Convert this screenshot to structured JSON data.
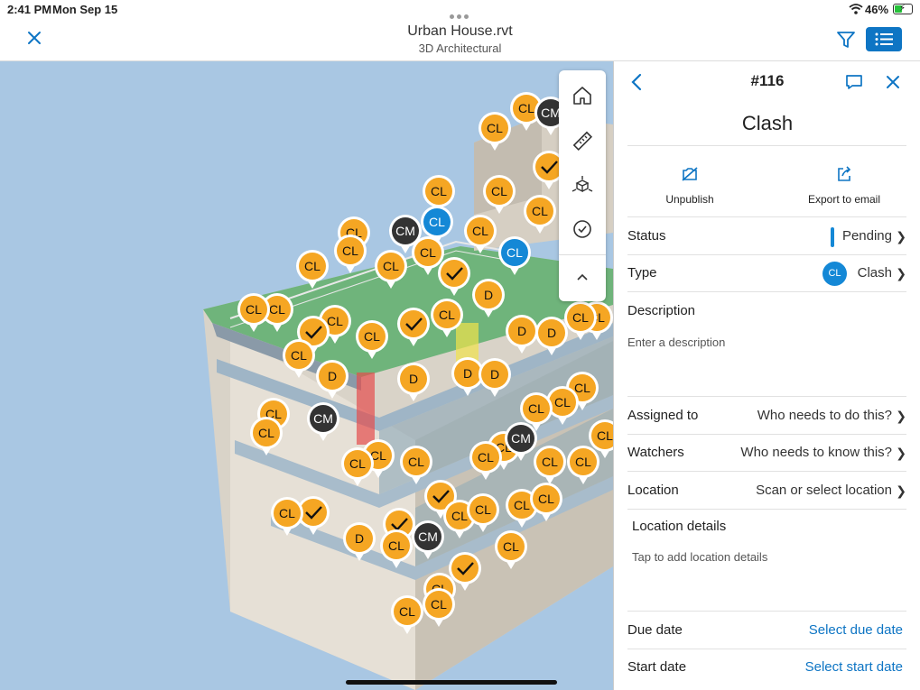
{
  "status_bar": {
    "time": "2:41 PM",
    "date": "Mon Sep 15",
    "battery": "46%",
    "battery_level": 0.46
  },
  "header": {
    "title": "Urban House.rvt",
    "subtitle": "3D Architectural"
  },
  "colors": {
    "accent": "#0e75c4",
    "pin_orange": "#f5a623",
    "pin_dark": "#333333",
    "pin_blue": "#1488d6",
    "sky": "#a9c7e3"
  },
  "toolbar": {
    "tools": [
      {
        "name": "home-icon"
      },
      {
        "name": "measure-icon"
      },
      {
        "name": "explode-icon"
      },
      {
        "name": "check-circle-icon"
      },
      {
        "name": "chevron-up-icon"
      }
    ]
  },
  "pins": [
    {
      "l": "CL",
      "t": "o"
    },
    {
      "l": "CM",
      "t": "d"
    },
    {
      "l": "CL",
      "t": "o"
    },
    {
      "l": "",
      "t": "c"
    },
    {
      "l": "CL",
      "t": "o"
    },
    {
      "l": "CL",
      "t": "o"
    },
    {
      "l": "CL",
      "t": "b"
    },
    {
      "l": "CL",
      "t": "o"
    },
    {
      "l": "CL",
      "t": "o"
    },
    {
      "l": "CM",
      "t": "d"
    },
    {
      "l": "CL",
      "t": "o"
    },
    {
      "l": "CL",
      "t": "o"
    },
    {
      "l": "CL",
      "t": "o"
    },
    {
      "l": "CL",
      "t": "b"
    },
    {
      "l": "",
      "t": "c"
    },
    {
      "l": "CL",
      "t": "o"
    },
    {
      "l": "CL",
      "t": "o"
    },
    {
      "l": "CL",
      "t": "o"
    },
    {
      "l": "D",
      "t": "o"
    },
    {
      "l": "CL",
      "t": "o"
    },
    {
      "l": "CL",
      "t": "o"
    },
    {
      "l": "CL",
      "t": "o"
    },
    {
      "l": "",
      "t": "c"
    },
    {
      "l": "",
      "t": "c"
    },
    {
      "l": "CL",
      "t": "o"
    },
    {
      "l": "D",
      "t": "o"
    },
    {
      "l": "D",
      "t": "o"
    },
    {
      "l": "CL",
      "t": "o"
    },
    {
      "l": "CL",
      "t": "o"
    },
    {
      "l": "CL",
      "t": "o"
    },
    {
      "l": "D",
      "t": "o"
    },
    {
      "l": "D",
      "t": "o"
    },
    {
      "l": "D",
      "t": "o"
    },
    {
      "l": "D",
      "t": "o"
    },
    {
      "l": "CL",
      "t": "o"
    },
    {
      "l": "CL",
      "t": "o"
    },
    {
      "l": "CL",
      "t": "o"
    },
    {
      "l": "CL",
      "t": "o"
    },
    {
      "l": "CL",
      "t": "o"
    },
    {
      "l": "CM",
      "t": "d"
    },
    {
      "l": "CL",
      "t": "o"
    },
    {
      "l": "CL",
      "t": "o"
    },
    {
      "l": "CL",
      "t": "o"
    },
    {
      "l": "CL",
      "t": "o"
    },
    {
      "l": "CM",
      "t": "d"
    },
    {
      "l": "CL",
      "t": "o"
    },
    {
      "l": "CL",
      "t": "o"
    },
    {
      "l": "CL",
      "t": "o"
    },
    {
      "l": "CL",
      "t": "o"
    },
    {
      "l": "",
      "t": "c"
    },
    {
      "l": "",
      "t": "c"
    },
    {
      "l": "CL",
      "t": "o"
    },
    {
      "l": "CL",
      "t": "o"
    },
    {
      "l": "CL",
      "t": "o"
    },
    {
      "l": "CL",
      "t": "o"
    },
    {
      "l": "D",
      "t": "o"
    },
    {
      "l": "",
      "t": "c"
    },
    {
      "l": "CL",
      "t": "o"
    },
    {
      "l": "CM",
      "t": "d"
    },
    {
      "l": "CL",
      "t": "o"
    },
    {
      "l": "CL",
      "t": "o"
    },
    {
      "l": "",
      "t": "c"
    },
    {
      "l": "CL",
      "t": "o"
    },
    {
      "l": "CL",
      "t": "o"
    },
    {
      "l": "CL",
      "t": "o"
    }
  ],
  "panel": {
    "issue_number": "#116",
    "title": "Clash",
    "actions": {
      "unpublish": "Unpublish",
      "export": "Export to email"
    },
    "status": {
      "label": "Status",
      "value": "Pending"
    },
    "type": {
      "label": "Type",
      "badge": "CL",
      "value": "Clash"
    },
    "description": {
      "label": "Description",
      "placeholder": "Enter a description"
    },
    "assigned": {
      "label": "Assigned to",
      "value": "Who needs to do this?"
    },
    "watchers": {
      "label": "Watchers",
      "value": "Who needs to know this?"
    },
    "location": {
      "label": "Location",
      "value": "Scan or select location"
    },
    "location_details": {
      "label": "Location details",
      "placeholder": "Tap to add location details"
    },
    "due_date": {
      "label": "Due date",
      "value": "Select due date"
    },
    "start_date": {
      "label": "Start date",
      "value": "Select start date"
    }
  }
}
